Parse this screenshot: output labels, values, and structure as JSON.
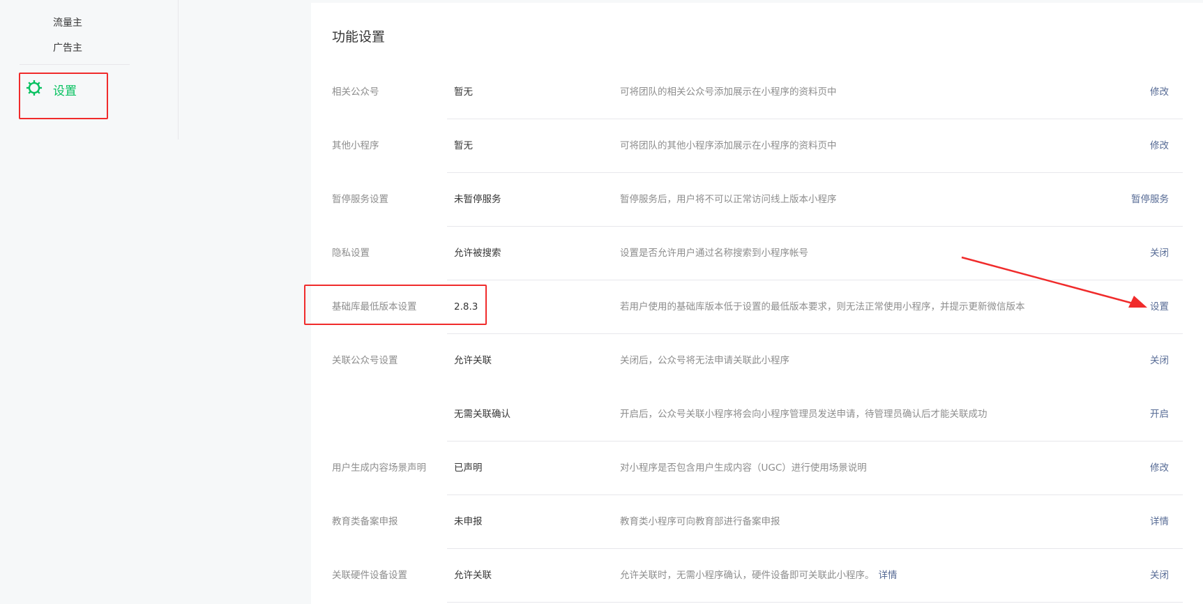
{
  "sidebar": {
    "sub_items": [
      {
        "label": "流量主"
      },
      {
        "label": "广告主"
      }
    ],
    "settings_label": "设置",
    "active_color": "#07c160",
    "settings_icon": "gear-icon"
  },
  "main": {
    "title": "功能设置",
    "rows": [
      {
        "label": "相关公众号",
        "value": "暂无",
        "desc": "可将团队的相关公众号添加展示在小程序的资料页中",
        "action": "修改"
      },
      {
        "label": "其他小程序",
        "value": "暂无",
        "desc": "可将团队的其他小程序添加展示在小程序的资料页中",
        "action": "修改"
      },
      {
        "label": "暂停服务设置",
        "value": "未暂停服务",
        "desc": "暂停服务后，用户将不可以正常访问线上版本小程序",
        "action": "暂停服务"
      },
      {
        "label": "隐私设置",
        "value": "允许被搜索",
        "desc": "设置是否允许用户通过名称搜索到小程序帐号",
        "action": "关闭"
      },
      {
        "label": "基础库最低版本设置",
        "value": "2.8.3",
        "desc": "若用户使用的基础库版本低于设置的最低版本要求，则无法正常使用小程序，并提示更新微信版本",
        "action": "设置"
      },
      {
        "label": "关联公众号设置",
        "value": "允许关联",
        "desc": "关闭后，公众号将无法申请关联此小程序",
        "action": "关闭"
      },
      {
        "label": "",
        "value": "无需关联确认",
        "desc": "开启后，公众号关联小程序将会向小程序管理员发送申请，待管理员确认后才能关联成功",
        "action": "开启"
      },
      {
        "label": "用户生成内容场景声明",
        "value": "已声明",
        "desc": "对小程序是否包含用户生成内容（UGC）进行使用场景说明",
        "action": "修改"
      },
      {
        "label": "教育类备案申报",
        "value": "未申报",
        "desc": "教育类小程序可向教育部进行备案申报",
        "action": "详情"
      },
      {
        "label": "关联硬件设备设置",
        "value": "允许关联",
        "desc": "允许关联时，无需小程序确认，硬件设备即可关联此小程序。",
        "desc_link": "详情",
        "action": "关闭"
      }
    ]
  },
  "colors": {
    "link": "#576b95",
    "annotation": "#f02b2b",
    "divider": "#e7e7eb"
  }
}
